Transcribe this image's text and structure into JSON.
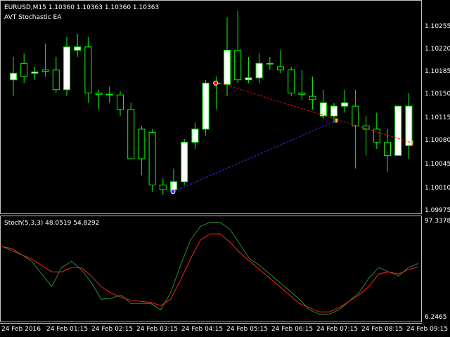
{
  "header": {
    "symbol_line": "EURUSD,M15  1.10360 1.10363 1.10360 1.10363",
    "ea_name": "AVT Stochastic EA"
  },
  "price_axis": {
    "labels": [
      "1.10255",
      "1.10220",
      "1.10185",
      "1.10150",
      "1.10115",
      "1.10080",
      "1.10045",
      "1.10010",
      "1.09975"
    ]
  },
  "stoch": {
    "label": "Stoch(5,3,3) 48.0519 54.8292",
    "max_label": "97.3378",
    "min_label": "6.2465"
  },
  "time_axis": {
    "labels": [
      "24 Feb 2016",
      "24 Feb 01:15",
      "24 Feb 02:15",
      "24 Feb 03:15",
      "24 Feb 04:15",
      "24 Feb 05:15",
      "24 Feb 06:15",
      "24 Feb 07:15",
      "24 Feb 08:15",
      "24 Feb 09:15"
    ]
  },
  "colors": {
    "background": "#000000",
    "candle_body": "#ffffff",
    "candle_wick": "#00ff00",
    "stoch_main": "#2e8b2e",
    "stoch_signal": "#ff2020",
    "sell_line": "#ff0000",
    "buy_line": "#3030ff"
  },
  "chart_data": {
    "type": "candlestick",
    "symbol": "EURUSD",
    "timeframe": "M15",
    "ylim": [
      1.09975,
      1.1029
    ],
    "candles": [
      {
        "o": 1.10175,
        "h": 1.1021,
        "l": 1.1015,
        "c": 1.10185
      },
      {
        "o": 1.102,
        "h": 1.10215,
        "l": 1.1017,
        "c": 1.1018
      },
      {
        "o": 1.10185,
        "h": 1.10195,
        "l": 1.10175,
        "c": 1.10187
      },
      {
        "o": 1.1019,
        "h": 1.1023,
        "l": 1.1018,
        "c": 1.10188
      },
      {
        "o": 1.1019,
        "h": 1.1021,
        "l": 1.10155,
        "c": 1.1016
      },
      {
        "o": 1.1016,
        "h": 1.1024,
        "l": 1.1015,
        "c": 1.10225
      },
      {
        "o": 1.1022,
        "h": 1.10245,
        "l": 1.1021,
        "c": 1.10225
      },
      {
        "o": 1.10225,
        "h": 1.1024,
        "l": 1.1014,
        "c": 1.10155
      },
      {
        "o": 1.10155,
        "h": 1.1016,
        "l": 1.1013,
        "c": 1.10153
      },
      {
        "o": 1.10153,
        "h": 1.10165,
        "l": 1.1014,
        "c": 1.10153
      },
      {
        "o": 1.10152,
        "h": 1.10158,
        "l": 1.1012,
        "c": 1.1013
      },
      {
        "o": 1.1013,
        "h": 1.1014,
        "l": 1.10055,
        "c": 1.10055
      },
      {
        "o": 1.101,
        "h": 1.10105,
        "l": 1.1003,
        "c": 1.10055
      },
      {
        "o": 1.10095,
        "h": 1.101,
        "l": 1.10005,
        "c": 1.10015
      },
      {
        "o": 1.10015,
        "h": 1.10025,
        "l": 1.1,
        "c": 1.10008
      },
      {
        "o": 1.10008,
        "h": 1.1004,
        "l": 1.10002,
        "c": 1.1002
      },
      {
        "o": 1.1002,
        "h": 1.10085,
        "l": 1.10015,
        "c": 1.1008
      },
      {
        "o": 1.1008,
        "h": 1.1011,
        "l": 1.1007,
        "c": 1.101
      },
      {
        "o": 1.101,
        "h": 1.10175,
        "l": 1.1009,
        "c": 1.1017
      },
      {
        "o": 1.1017,
        "h": 1.1018,
        "l": 1.1013,
        "c": 1.1017
      },
      {
        "o": 1.10168,
        "h": 1.1027,
        "l": 1.1015,
        "c": 1.1022
      },
      {
        "o": 1.1022,
        "h": 1.1028,
        "l": 1.1017,
        "c": 1.10175
      },
      {
        "o": 1.10175,
        "h": 1.1021,
        "l": 1.1017,
        "c": 1.10178
      },
      {
        "o": 1.10178,
        "h": 1.10215,
        "l": 1.1017,
        "c": 1.102
      },
      {
        "o": 1.102,
        "h": 1.1021,
        "l": 1.1019,
        "c": 1.102
      },
      {
        "o": 1.10195,
        "h": 1.1022,
        "l": 1.10185,
        "c": 1.1019
      },
      {
        "o": 1.1019,
        "h": 1.10195,
        "l": 1.1015,
        "c": 1.10155
      },
      {
        "o": 1.10155,
        "h": 1.1019,
        "l": 1.10145,
        "c": 1.10153
      },
      {
        "o": 1.1015,
        "h": 1.1018,
        "l": 1.1013,
        "c": 1.10145
      },
      {
        "o": 1.1012,
        "h": 1.1016,
        "l": 1.10115,
        "c": 1.1014
      },
      {
        "o": 1.1012,
        "h": 1.1014,
        "l": 1.1011,
        "c": 1.10135
      },
      {
        "o": 1.10135,
        "h": 1.1016,
        "l": 1.10125,
        "c": 1.1014
      },
      {
        "o": 1.10135,
        "h": 1.1016,
        "l": 1.1004,
        "c": 1.10105
      },
      {
        "o": 1.10105,
        "h": 1.1012,
        "l": 1.1006,
        "c": 1.101
      },
      {
        "o": 1.101,
        "h": 1.10125,
        "l": 1.1007,
        "c": 1.1008
      },
      {
        "o": 1.1008,
        "h": 1.101,
        "l": 1.10035,
        "c": 1.1006
      },
      {
        "o": 1.1006,
        "h": 1.10135,
        "l": 1.1006,
        "c": 1.10135
      },
      {
        "o": 1.10075,
        "h": 1.10155,
        "l": 1.10055,
        "c": 1.10135
      }
    ],
    "stoch_main": [
      74,
      70,
      66,
      60,
      48,
      36,
      54,
      60,
      52,
      40,
      24,
      25,
      28,
      20,
      20,
      20,
      14,
      30,
      56,
      80,
      93,
      97,
      97,
      90,
      76,
      62,
      56,
      48,
      40,
      32,
      24,
      14,
      10,
      10,
      14,
      22,
      30,
      44,
      54,
      50,
      46,
      54,
      58
    ],
    "stoch_signal": [
      74,
      72,
      66,
      62,
      56,
      50,
      50,
      54,
      54,
      46,
      36,
      30,
      26,
      23,
      22,
      21,
      18,
      24,
      42,
      62,
      80,
      86,
      86,
      78,
      68,
      60,
      52,
      44,
      36,
      28,
      20,
      16,
      12,
      12,
      16,
      22,
      28,
      36,
      48,
      50,
      48,
      52,
      55
    ],
    "stoch_range": [
      6.2465,
      97.3378
    ]
  }
}
